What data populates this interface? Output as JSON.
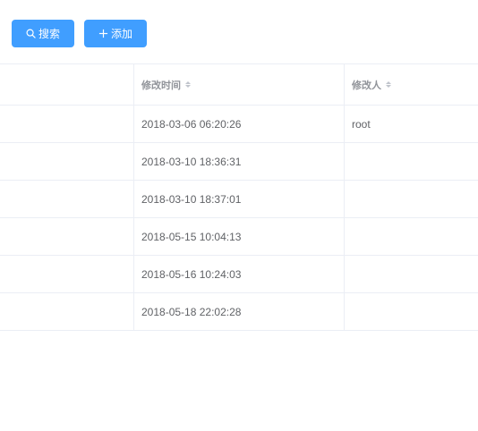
{
  "toolbar": {
    "search_label": "搜索",
    "add_label": "添加",
    "accent_color": "#409eff"
  },
  "table": {
    "columns": [
      {
        "label": ""
      },
      {
        "label": "修改时间"
      },
      {
        "label": "修改人"
      }
    ],
    "rows": [
      {
        "modified_time": "2018-03-06 06:20:26",
        "modifier": "root"
      },
      {
        "modified_time": "2018-03-10 18:36:31",
        "modifier": ""
      },
      {
        "modified_time": "2018-03-10 18:37:01",
        "modifier": ""
      },
      {
        "modified_time": "2018-05-15 10:04:13",
        "modifier": ""
      },
      {
        "modified_time": "2018-05-16 10:24:03",
        "modifier": ""
      },
      {
        "modified_time": "2018-05-18 22:02:28",
        "modifier": ""
      }
    ]
  }
}
